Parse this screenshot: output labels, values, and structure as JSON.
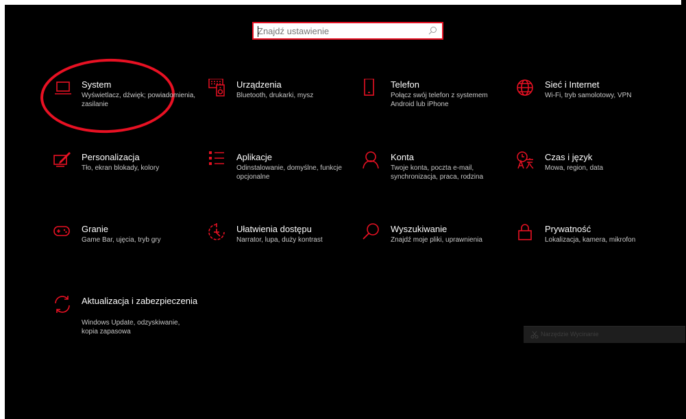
{
  "search": {
    "placeholder": "Znajdź ustawienie"
  },
  "accent": "#e81123",
  "tiles": [
    {
      "icon": "laptop-icon",
      "title": "System",
      "desc": "Wyświetlacz, dźwięk; powiadomienia, zasilanie"
    },
    {
      "icon": "devices-icon",
      "title": "Urządzenia",
      "desc": "Bluetooth, drukarki, mysz"
    },
    {
      "icon": "phone-icon",
      "title": "Telefon",
      "desc": "Połącz swój telefon z systemem Android lub iPhone"
    },
    {
      "icon": "globe-icon",
      "title": "Sieć i Internet",
      "desc": "Wi-Fi, tryb samolotowy, VPN"
    },
    {
      "icon": "personalization-icon",
      "title": "Personalizacja",
      "desc": "Tło, ekran blokady, kolory"
    },
    {
      "icon": "apps-list-icon",
      "title": "Aplikacje",
      "desc": "Odinstalowanie, domyślne, funkcje opcjonalne"
    },
    {
      "icon": "person-icon",
      "title": "Konta",
      "desc": "Twoje konta, poczta e-mail, synchronizacja, praca, rodzina"
    },
    {
      "icon": "time-language-icon",
      "title": "Czas i język",
      "desc": "Mowa, region, data"
    },
    {
      "icon": "gamepad-icon",
      "title": "Granie",
      "desc": "Game Bar, ujęcia, tryb gry"
    },
    {
      "icon": "accessibility-icon",
      "title": "Ułatwienia dostępu",
      "desc": "Narrator, lupa, duży kontrast"
    },
    {
      "icon": "search-icon",
      "title": "Wyszukiwanie",
      "desc": "Znajdź moje pliki, uprawnienia"
    },
    {
      "icon": "lock-icon",
      "title": "Prywatność",
      "desc": "Lokalizacja, kamera, mikrofon"
    },
    {
      "icon": "update-icon",
      "title": "Aktualizacja i zabezpieczenia",
      "desc": "Windows Update, odzyskiwanie, kopia zapasowa"
    }
  ],
  "tooltip": {
    "icon": "snipping-icon",
    "text": "Narzędzie Wycinanie"
  }
}
